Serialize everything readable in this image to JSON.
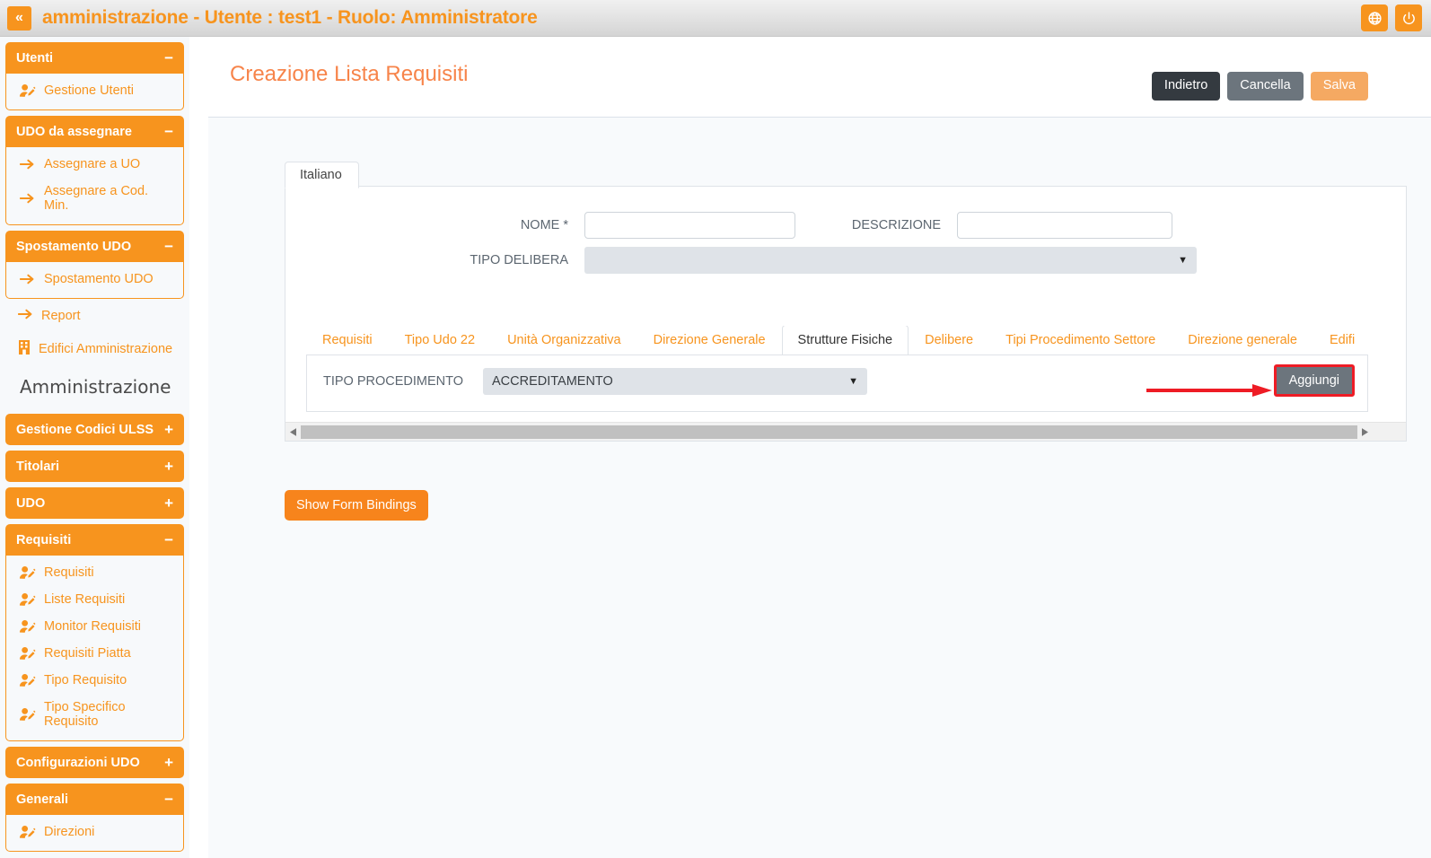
{
  "topbar": {
    "collapse_label": "«",
    "title": "amministrazione - Utente : test1 - Ruolo: Amministratore",
    "language_icon": "globe-icon",
    "power_icon": "power-icon",
    "accent": "#f7941e"
  },
  "sidebar": {
    "section_title": "Amministrazione",
    "panels": [
      {
        "label": "Utenti",
        "sign": "−",
        "open": true,
        "items": [
          {
            "label": "Gestione Utenti",
            "icon": "user-edit-icon"
          }
        ]
      },
      {
        "label": "UDO da assegnare",
        "sign": "−",
        "open": true,
        "items": [
          {
            "label": "Assegnare a UO",
            "icon": "arrow-right-icon"
          },
          {
            "label": "Assegnare a Cod. Min.",
            "icon": "arrow-right-icon"
          }
        ]
      },
      {
        "label": "Spostamento UDO",
        "sign": "−",
        "open": true,
        "items": [
          {
            "label": "Spostamento UDO",
            "icon": "arrow-right-icon"
          }
        ]
      }
    ],
    "loose_items": [
      {
        "label": "Report",
        "icon": "arrow-right-icon"
      },
      {
        "label": "Edifici Amministrazione",
        "icon": "building-icon"
      }
    ],
    "panels2": [
      {
        "label": "Gestione Codici ULSS",
        "sign": "+",
        "open": false,
        "items": []
      },
      {
        "label": "Titolari",
        "sign": "+",
        "open": false,
        "items": []
      },
      {
        "label": "UDO",
        "sign": "+",
        "open": false,
        "items": []
      },
      {
        "label": "Requisiti",
        "sign": "−",
        "open": true,
        "items": [
          {
            "label": "Requisiti",
            "icon": "user-edit-icon"
          },
          {
            "label": "Liste Requisiti",
            "icon": "user-edit-icon"
          },
          {
            "label": "Monitor Requisiti",
            "icon": "user-edit-icon"
          },
          {
            "label": "Requisiti Piatta",
            "icon": "user-edit-icon"
          },
          {
            "label": "Tipo Requisito",
            "icon": "user-edit-icon"
          },
          {
            "label": "Tipo Specifico Requisito",
            "icon": "user-edit-icon"
          }
        ]
      },
      {
        "label": "Configurazioni UDO",
        "sign": "+",
        "open": false,
        "items": []
      },
      {
        "label": "Generali",
        "sign": "−",
        "open": true,
        "items": [
          {
            "label": "Direzioni",
            "icon": "user-edit-icon"
          }
        ]
      }
    ]
  },
  "page": {
    "title": "Creazione Lista Requisiti",
    "actions": [
      {
        "label": "Indietro",
        "style": "dark"
      },
      {
        "label": "Cancella",
        "style": "gray"
      },
      {
        "label": "Salva",
        "style": "orange-light"
      }
    ]
  },
  "form": {
    "lang_tab": "Italiano",
    "nome_label": "NOME *",
    "nome_value": "",
    "nome_placeholder": "",
    "descrizione_label": "DESCRIZIONE",
    "descrizione_value": "",
    "descrizione_placeholder": "",
    "tipo_delibera_label": "TIPO DELIBERA",
    "tipo_delibera_value": "",
    "tabs": [
      {
        "label": "Requisiti",
        "active": false
      },
      {
        "label": "Tipo Udo 22",
        "active": false
      },
      {
        "label": "Unità Organizzativa",
        "active": false
      },
      {
        "label": "Direzione Generale",
        "active": false
      },
      {
        "label": "Strutture Fisiche",
        "active": true
      },
      {
        "label": "Delibere",
        "active": false
      },
      {
        "label": "Tipi Procedimento Settore",
        "active": false
      },
      {
        "label": "Direzione generale",
        "active": false
      },
      {
        "label": "Edifi",
        "active": false
      }
    ],
    "tipo_procedimento_label": "TIPO PROCEDIMENTO",
    "tipo_procedimento_value": "ACCREDITAMENTO",
    "aggiungi_label": "Aggiungi",
    "highlight_color": "#ee1c25"
  },
  "footer": {
    "show_form_bindings_label": "Show Form Bindings"
  }
}
